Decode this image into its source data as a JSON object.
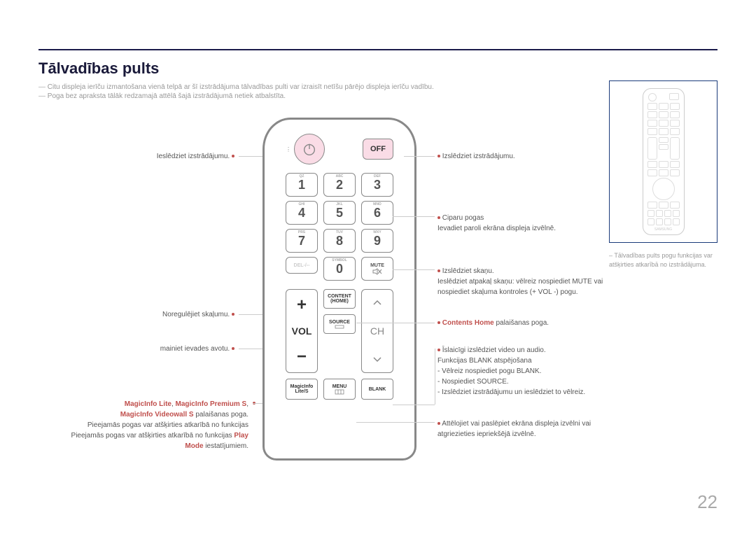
{
  "title": "Tālvadības pults",
  "notes": [
    "Citu displeja ierīču izmantošana vienā telpā ar šī izstrādājuma tālvadības pulti var izraisīt netīšu pārējo displeja ierīču vadību.",
    "Poga bez apraksta tālāk redzamajā attēlā šajā izstrādājumā netiek atbalstīta."
  ],
  "labels": {
    "power_on": "Ieslēdziet izstrādājumu.",
    "power_off": "Izslēdziet izstrādājumu.",
    "digits_title": "Ciparu pogas",
    "digits_desc": "Ievadiet paroli ekrāna displeja izvēlnē.",
    "mute_title": "Izslēdziet skaņu.",
    "mute_desc": "Ieslēdziet atpakaļ skaņu: vēlreiz nospiediet MUTE vai nospiediet skaļuma kontroles (+ VOL -) pogu.",
    "volume": "Noregulējiet skaļumu.",
    "source_change": "mainiet ievades avotu.",
    "content_home": "Contents Home",
    "content_home_desc": " palaišanas poga.",
    "blank_title": "Īslaicīgi izslēdziet video un audio.",
    "blank_l1": "Funkcijas BLANK atspējošana",
    "blank_l2": "- Vēlreiz nospiediet pogu BLANK.",
    "blank_l3": "- Nospiediet SOURCE.",
    "blank_l4": "- Izslēdziet izstrādājumu un ieslēdziet to vēlreiz.",
    "menu": "Attēlojiet vai paslēpiet ekrāna displeja izvēlni vai atgriezieties iepriekšējā izvēlnē.",
    "magic_l1a": "MagicInfo Lite",
    "magic_l1b": "MagicInfo Premium S",
    "magic_l2a": "MagicInfo Videowall S",
    "magic_l2b": " palaišanas poga.",
    "magic_l3": "Pieejamās pogas var atšķirties atkarībā no funkcijas ",
    "magic_l3b": "Play Mode",
    "magic_l3c": " iestatījumiem."
  },
  "buttons": {
    "off": "OFF",
    "n1": "1",
    "n2": "2",
    "n3": "3",
    "n4": "4",
    "n5": "5",
    "n6": "6",
    "n7": "7",
    "n8": "8",
    "n9": "9",
    "n0": "0",
    "s1": "QZ",
    "s2": "ABC",
    "s3": "DEF",
    "s4": "GHI",
    "s5": "JKL",
    "s6": "MNO",
    "s7": "PRS",
    "s8": "TUV",
    "s9": "WXY",
    "del": "DEL-/--",
    "symbol": "SYMBOL",
    "mute": "MUTE",
    "vol": "VOL",
    "ch": "CH",
    "content_home": "CONTENT (HOME)",
    "source": "SOURCE",
    "magic": "MagicInfo Lite/S",
    "menu": "MENU",
    "blank": "BLANK"
  },
  "sidebar_note": "Tālvadības pults pogu funkcijas var atšķirties atkarībā no izstrādājuma.",
  "samsung": "SAMSUNG",
  "page": "22"
}
